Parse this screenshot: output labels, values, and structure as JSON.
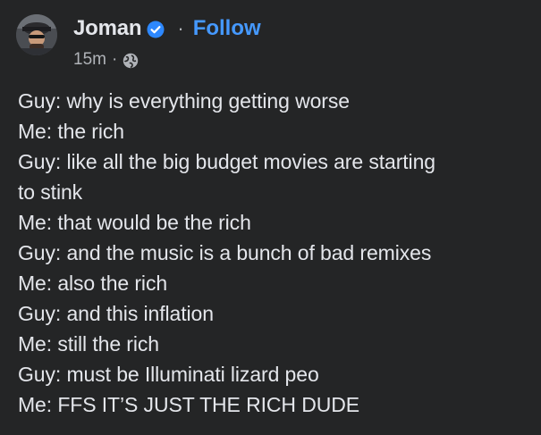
{
  "header": {
    "author_name": "Joman",
    "follow_label": "Follow",
    "separator": "·",
    "timestamp": "15m",
    "meta_separator": "·",
    "verified_icon": "verified-badge-icon",
    "privacy_icon": "globe-icon"
  },
  "colors": {
    "background": "#242526",
    "text": "#e4e6eb",
    "secondary_text": "#b0b3b8",
    "link": "#4599ff",
    "verified": "#2d88ff"
  },
  "post": {
    "lines": [
      "Guy: why is everything getting worse",
      "Me: the rich",
      "Guy: like all the big budget movies are starting",
      "to stink",
      "Me: that would be the rich",
      "Guy: and the music is a bunch of bad remixes",
      "Me: also the rich",
      "Guy: and this inflation",
      "Me: still the rich",
      "Guy: must be Illuminati lizard peo",
      "Me: FFS IT’S JUST THE RICH DUDE"
    ]
  }
}
